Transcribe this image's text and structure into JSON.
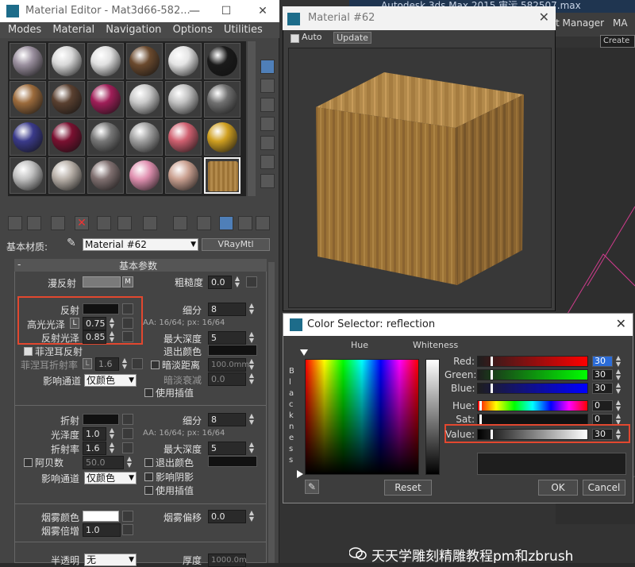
{
  "background": {
    "title": "Autodesk 3ds Max 2015    审污 582507.max",
    "toolbar_text": "ect Manager",
    "toolbar_text2": "MA",
    "create_sel": "Create S"
  },
  "material_editor": {
    "title": "Material Editor - Mat3d66-582...",
    "menu": [
      "Modes",
      "Material",
      "Navigation",
      "Options",
      "Utilities"
    ],
    "basic_material_label": "基本材质:",
    "material_name": "Material #62",
    "material_type": "VRayMtl",
    "rollout_title": "基本参数",
    "rollout_toggle": "-",
    "diffuse": {
      "label": "漫反射",
      "map_btn": "M",
      "roughness_label": "粗糙度",
      "roughness": "0.0"
    },
    "reflect": {
      "label": "反射",
      "hilight_label": "高光光泽",
      "hilight_lock": "L",
      "hilight_value": "0.75",
      "gloss_label": "反射光泽",
      "gloss_value": "0.85",
      "subdivs_label": "细分",
      "subdivs": "8",
      "aa_text": "AA: 16/64; px: 16/64",
      "max_depth_label": "最大深度",
      "max_depth": "5",
      "fresnel_label": "菲涅耳反射",
      "exit_color_label": "退出颜色",
      "fresnel_ior_label": "菲涅耳折射率",
      "fresnel_ior_lock": "L",
      "fresnel_ior": "1.6",
      "dim_dist_label": "暗淡距离",
      "dim_dist": "100.0mm",
      "affect_channels_label": "影响通道",
      "affect_channels": "仅颜色",
      "dim_falloff_label": "暗淡衰减",
      "dim_falloff": "0.0",
      "interp_label": "使用插值"
    },
    "refract": {
      "label": "折射",
      "subdivs_label": "细分",
      "subdivs": "8",
      "gloss_label": "光泽度",
      "gloss": "1.0",
      "aa_text": "AA: 16/64; px: 16/64",
      "ior_label": "折射率",
      "ior": "1.6",
      "max_depth_label": "最大深度",
      "max_depth": "5",
      "abbe_label": "阿贝数",
      "abbe": "50.0",
      "exit_color_label": "退出颜色",
      "affect_shadows_label": "影响阴影",
      "affect_channels_label": "影响通道",
      "affect_channels": "仅颜色",
      "interp_label": "使用插值"
    },
    "fog": {
      "color_label": "烟雾颜色",
      "bias_label": "烟雾偏移",
      "bias": "0.0",
      "mult_label": "烟雾倍增",
      "mult": "1.0"
    },
    "translucency": {
      "label": "半透明",
      "value": "无",
      "thickness_label": "厚度",
      "thickness": "1000.0m"
    }
  },
  "preview": {
    "title": "Material #62",
    "auto_label": "Auto",
    "update_label": "Update"
  },
  "color_selector": {
    "title": "Color Selector: reflection",
    "hue_label": "Hue",
    "whiteness_label": "Whiteness",
    "blackness_letters": [
      "B",
      "l",
      "a",
      "c",
      "k",
      "n",
      "e",
      "s",
      "s"
    ],
    "channels": [
      {
        "label": "Red:",
        "value": "30"
      },
      {
        "label": "Green:",
        "value": "30"
      },
      {
        "label": "Blue:",
        "value": "30"
      },
      {
        "label": "Hue:",
        "value": "0"
      },
      {
        "label": "Sat:",
        "value": "0"
      },
      {
        "label": "Value:",
        "value": "30"
      }
    ],
    "reset_label": "Reset",
    "ok_label": "OK",
    "cancel_label": "Cancel"
  },
  "watermark": "天天学雕刻精雕教程pm和zbrush",
  "colors": {
    "highlight_box": "#e2472f",
    "accent": "#2b6cd8"
  }
}
